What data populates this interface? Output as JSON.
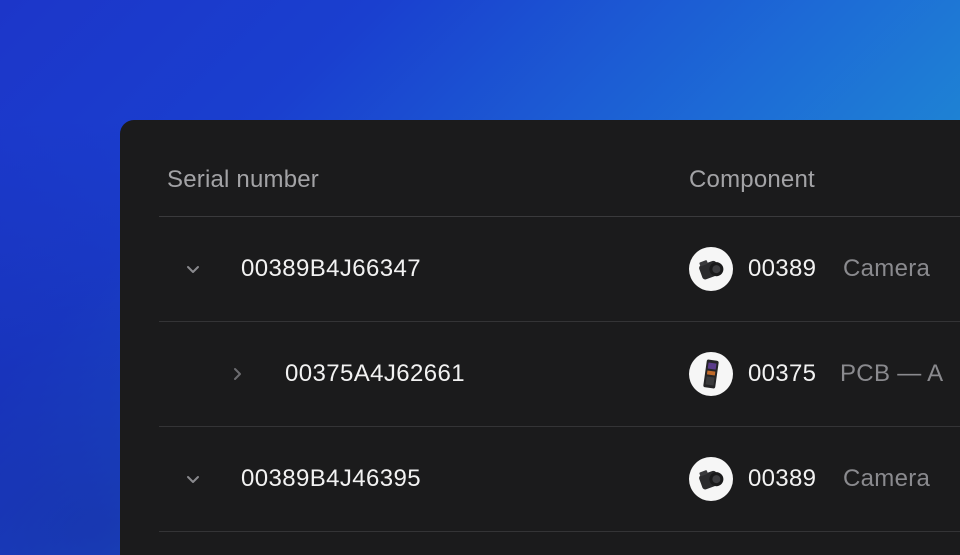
{
  "table": {
    "columns": {
      "serial": "Serial number",
      "component": "Component"
    },
    "rows": [
      {
        "expanded": true,
        "serial": "00389B4J66347",
        "component_code": "00389",
        "component_name": "Camera",
        "component_icon": "camera-icon"
      },
      {
        "expanded": false,
        "serial": "00375A4J62661",
        "component_code": "00375",
        "component_name": "PCB — A",
        "component_icon": "pcb-icon"
      },
      {
        "expanded": true,
        "serial": "00389B4J46395",
        "component_code": "00389",
        "component_name": "Camera",
        "component_icon": "camera-icon"
      }
    ]
  }
}
